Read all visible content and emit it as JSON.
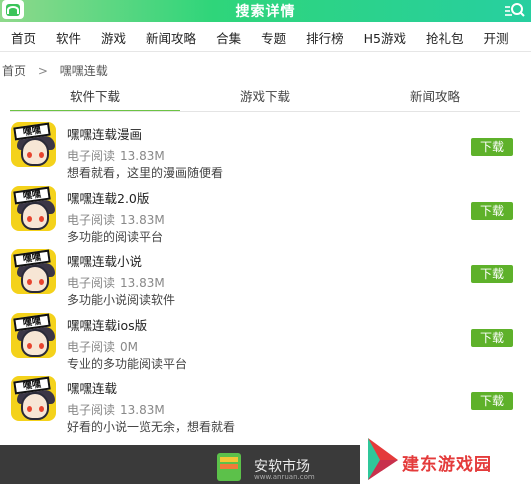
{
  "header": {
    "title": "搜索详情"
  },
  "nav": [
    "首页",
    "软件",
    "游戏",
    "新闻攻略",
    "合集",
    "专题",
    "排行榜",
    "H5游戏",
    "抢礼包",
    "开测"
  ],
  "breadcrumb": {
    "home": "首页",
    "sep": ">",
    "current": "嘿嘿连载"
  },
  "tabs": [
    {
      "label": "软件下载",
      "active": true
    },
    {
      "label": "游戏下载",
      "active": false
    },
    {
      "label": "新闻攻略",
      "active": false
    }
  ],
  "items": [
    {
      "name": "嘿嘿连载漫画",
      "category": "电子阅读",
      "size": "13.83M",
      "desc": "想看就看，这里的漫画随便看",
      "button": "下载",
      "icon_text": "嘿嘿"
    },
    {
      "name": "嘿嘿连载2.0版",
      "category": "电子阅读",
      "size": "13.83M",
      "desc": "多功能的阅读平台",
      "button": "下载",
      "icon_text": "嘿嘿"
    },
    {
      "name": "嘿嘿连载小说",
      "category": "电子阅读",
      "size": "13.83M",
      "desc": "多功能小说阅读软件",
      "button": "下载",
      "icon_text": "嘿嘿"
    },
    {
      "name": "嘿嘿连载ios版",
      "category": "电子阅读",
      "size": "0M",
      "desc": "专业的多功能阅读平台",
      "button": "下载",
      "icon_text": "嘿嘿"
    },
    {
      "name": "嘿嘿连载",
      "category": "电子阅读",
      "size": "13.83M",
      "desc": "好看的小说一览无余，想看就看",
      "button": "下载",
      "icon_text": "嘿嘿"
    }
  ],
  "footer_ad": {
    "title": "安软市场",
    "sub": "www.anruan.com"
  },
  "watermark": {
    "text": "建东游戏园"
  },
  "colors": {
    "accent": "#5eb12a",
    "header_start": "#8fd98b",
    "header_end": "#27cfa0",
    "watermark": "#e43b3b"
  }
}
